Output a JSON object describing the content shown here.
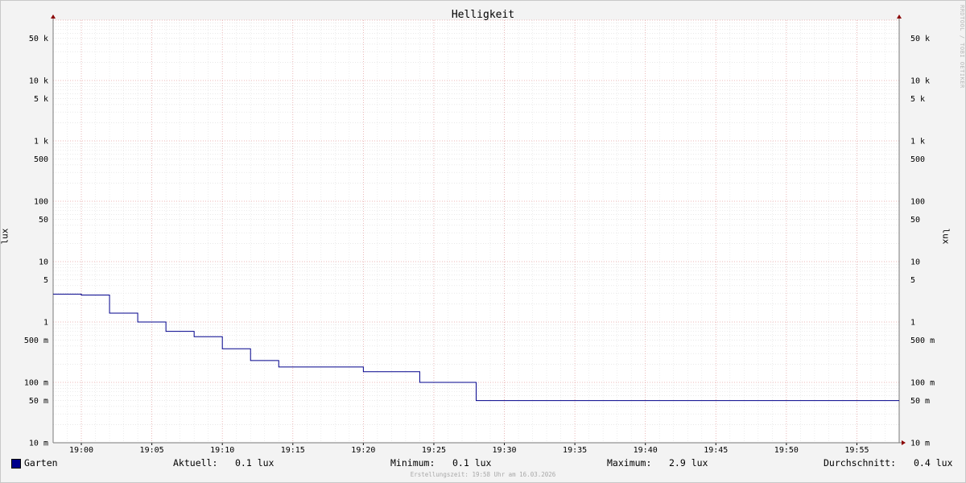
{
  "chart_data": {
    "type": "line",
    "title": "Helligkeit",
    "ylabel": "lux",
    "y_scale": "log",
    "ylim": [
      0.01,
      100000
    ],
    "y_ticks": [
      {
        "v": 50000,
        "label": "50 k"
      },
      {
        "v": 10000,
        "label": "10 k"
      },
      {
        "v": 5000,
        "label": "5 k"
      },
      {
        "v": 1000,
        "label": "1 k"
      },
      {
        "v": 500,
        "label": "500"
      },
      {
        "v": 100,
        "label": "100"
      },
      {
        "v": 50,
        "label": "50"
      },
      {
        "v": 10,
        "label": "10"
      },
      {
        "v": 5,
        "label": "5"
      },
      {
        "v": 1,
        "label": "1"
      },
      {
        "v": 0.5,
        "label": "500 m"
      },
      {
        "v": 0.1,
        "label": "100 m"
      },
      {
        "v": 0.05,
        "label": "50 m"
      },
      {
        "v": 0.01,
        "label": "10 m"
      }
    ],
    "x_ticks": [
      "19:00",
      "19:05",
      "19:10",
      "19:15",
      "19:20",
      "19:25",
      "19:30",
      "19:35",
      "19:40",
      "19:45",
      "19:50",
      "19:55"
    ],
    "xlim": [
      "18:58",
      "19:58"
    ],
    "series": [
      {
        "name": "Garten",
        "color": "#00008b",
        "points": [
          [
            "18:58",
            2.9
          ],
          [
            "19:00",
            2.8
          ],
          [
            "19:02",
            1.4
          ],
          [
            "19:04",
            1.0
          ],
          [
            "19:06",
            0.7
          ],
          [
            "19:08",
            0.57
          ],
          [
            "19:10",
            0.36
          ],
          [
            "19:12",
            0.23
          ],
          [
            "19:14",
            0.18
          ],
          [
            "19:20",
            0.15
          ],
          [
            "19:24",
            0.1
          ],
          [
            "19:28",
            0.05
          ],
          [
            "19:30",
            0.05
          ],
          [
            "19:58",
            0.05
          ]
        ]
      }
    ],
    "grid": true,
    "legend_position": "bottom"
  },
  "watermark": "RRDTOOL / TOBI OETIKER",
  "legend": {
    "series_label": "Garten",
    "current_label": "Aktuell:",
    "current_value": "0.1 lux",
    "min_label": "Minimum:",
    "min_value": "0.1 lux",
    "max_label": "Maximum:",
    "max_value": "2.9 lux",
    "avg_label": "Durchschnitt:",
    "avg_value": "0.4 lux"
  },
  "footer": "Erstellungszeit: 19:58 Uhr am 16.03.2026"
}
